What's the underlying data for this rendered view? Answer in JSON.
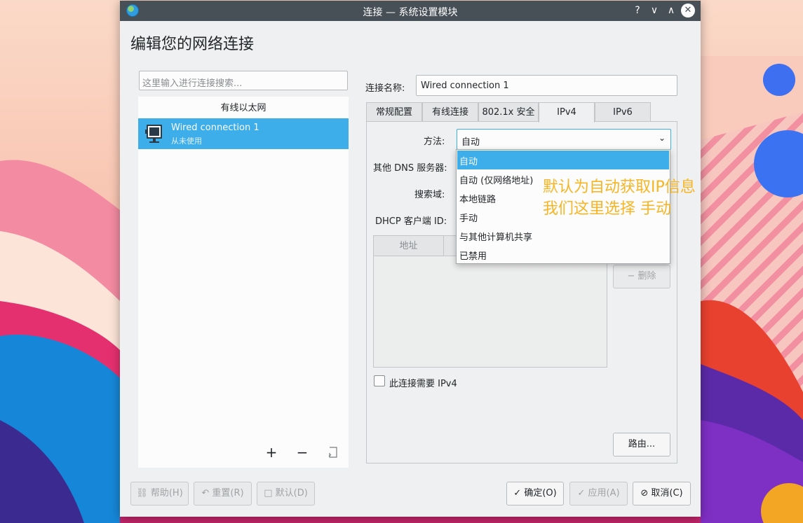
{
  "window": {
    "title": "连接 — 系统设置模块",
    "controls": {
      "help": "?",
      "minimize": "∨",
      "maximize": "∧",
      "close": "✕"
    }
  },
  "page_title": "编辑您的网络连接",
  "left": {
    "search_placeholder": "这里输入进行连接搜索...",
    "group_header": "有线以太网",
    "connections": [
      {
        "name": "Wired connection 1",
        "status": "从未使用",
        "icon": "network-wired-icon"
      }
    ],
    "buttons": {
      "add": "+",
      "remove": "−",
      "import": "import-icon"
    }
  },
  "right": {
    "connection_name_label": "连接名称:",
    "connection_name_value": "Wired connection 1",
    "tabs": [
      "常规配置",
      "有线连接",
      "802.1x 安全",
      "IPv4",
      "IPv6"
    ],
    "active_tab": "IPv4",
    "ipv4": {
      "method_label": "方法:",
      "method_value": "自动",
      "dns_label": "其他 DNS 服务器:",
      "search_domain_label": "搜索域:",
      "dhcp_label": "DHCP 客户端 ID:",
      "address_column": "地址",
      "delete_button": "删除",
      "require_ipv4_label": "此连接需要 IPv4",
      "require_ipv4_checked": false,
      "routes_button": "路由..."
    }
  },
  "method_dropdown": {
    "options": [
      "自动",
      "自动 (仅网络地址)",
      "本地链路",
      "手动",
      "与其他计算机共享",
      "已禁用"
    ],
    "selected_index": 0
  },
  "annotation": {
    "line1": "默认为自动获取IP信息",
    "line2": "我们这里选择 手动",
    "color": "#f7b524"
  },
  "footer": {
    "help": "帮助(H)",
    "reset": "重置(R)",
    "defaults": "默认(D)",
    "ok": "确定(O)",
    "apply": "应用(A)",
    "cancel": "取消(C)"
  },
  "colors": {
    "accent": "#3daee9",
    "titlebar": "#475057",
    "window_bg": "#eff0f1"
  }
}
